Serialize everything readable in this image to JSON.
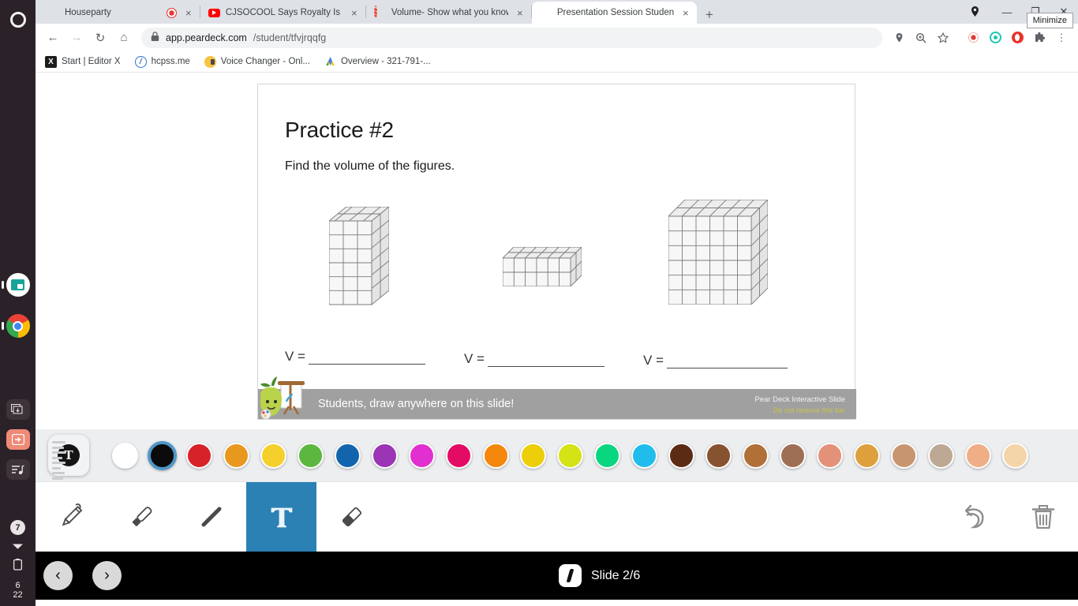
{
  "os_sidebar": {
    "top_icon": "circle-icon",
    "apps": [
      {
        "name": "files-app",
        "icon": "teal-folder-icon"
      },
      {
        "name": "chrome-app",
        "icon": "chrome-icon"
      }
    ],
    "tray": [
      {
        "name": "screenshot-icon"
      },
      {
        "name": "login-icon"
      },
      {
        "name": "music-playlist-icon"
      }
    ],
    "status": {
      "badge": "7",
      "wifi_icon": "wifi-icon",
      "battery_icon": "battery-icon"
    },
    "clock": {
      "line1": "6",
      "line2": "22"
    }
  },
  "browser": {
    "tabs": [
      {
        "title": "Houseparty",
        "favicon": "houseparty-icon",
        "active": false,
        "has_record_dot": true,
        "close_label": "×"
      },
      {
        "title": "CJSOCOOL Says Royalty Is For T",
        "favicon": "youtube-icon",
        "active": false,
        "close_label": "×"
      },
      {
        "title": "Volume- Show what you know",
        "favicon": "loading-icon",
        "active": false,
        "close_label": "×"
      },
      {
        "title": "Presentation Session Student",
        "favicon": "peardeck-icon",
        "active": true,
        "close_label": "×"
      }
    ],
    "new_tab_label": "+",
    "window_controls": {
      "location_icon": "location-pin-icon",
      "minimize": "—",
      "maximize": "❐",
      "close": "✕",
      "tooltip": "Minimize"
    },
    "nav": {
      "back": "←",
      "forward": "→",
      "reload": "↻",
      "home": "⌂"
    },
    "url": {
      "lock_icon": "lock-icon",
      "domain": "app.peardeck.com",
      "path": "/student/tfvjrqqfg"
    },
    "omni_icons": [
      {
        "name": "location-pin-icon",
        "glyph": "◎"
      },
      {
        "name": "zoom-search-icon",
        "glyph": "⌕"
      },
      {
        "name": "bookmark-star-icon",
        "glyph": "☆"
      },
      {
        "name": "recorder-extension-icon",
        "glyph": ""
      },
      {
        "name": "grammar-extension-icon",
        "glyph": ""
      },
      {
        "name": "adblock-extension-icon",
        "glyph": ""
      },
      {
        "name": "extensions-puzzle-icon",
        "glyph": "❖"
      },
      {
        "name": "chrome-menu-icon",
        "glyph": "⋮"
      }
    ],
    "bookmarks": [
      {
        "label": "Start | Editor X",
        "icon": "editorx-icon"
      },
      {
        "label": "hcpss.me",
        "icon": "hcpss-icon"
      },
      {
        "label": "Voice Changer - Onl...",
        "icon": "voicechanger-icon"
      },
      {
        "label": "Overview - 321-791-...",
        "icon": "google-meet-icon"
      }
    ]
  },
  "slide": {
    "title": "Practice #2",
    "subtitle": "Find the volume of the figures.",
    "answers": [
      {
        "label": "V =",
        "value": ""
      },
      {
        "label": "V =",
        "value": ""
      },
      {
        "label": "V =",
        "value": ""
      }
    ],
    "figures": [
      {
        "name": "rectangular-prism-tall",
        "cols": 3,
        "rows": 6,
        "depth": 2
      },
      {
        "name": "rectangular-prism-flat",
        "cols": 6,
        "rows": 2,
        "depth": 2
      },
      {
        "name": "rectangular-prism-cube",
        "cols": 6,
        "rows": 6,
        "depth": 2
      }
    ],
    "peardeck_bar": {
      "message": "Students, draw anywhere on this slide!",
      "note_line1": "Pear Deck Interactive Slide",
      "note_line2": "Do not remove this bar",
      "bar_color": "#a0a0a0",
      "note1_color": "#f2f2f2",
      "note2_color": "#c9c44a",
      "mascot": "pear-mascot-icon"
    }
  },
  "palette": {
    "active_tool_badge": "text-tool-badge",
    "active_tool_glyph": "T",
    "selected_index": 1,
    "selection_ring_color": "#4f96c8",
    "swatches": [
      {
        "name": "white",
        "hex": "#ffffff"
      },
      {
        "name": "black",
        "hex": "#0b0b0b"
      },
      {
        "name": "red",
        "hex": "#d8222a"
      },
      {
        "name": "orange",
        "hex": "#e8981e"
      },
      {
        "name": "yellow",
        "hex": "#f5cf2c"
      },
      {
        "name": "green",
        "hex": "#5cb740"
      },
      {
        "name": "blue",
        "hex": "#1265ad"
      },
      {
        "name": "purple",
        "hex": "#9b34b5"
      },
      {
        "name": "magenta",
        "hex": "#e22fd0"
      },
      {
        "name": "pink",
        "hex": "#e30b64"
      },
      {
        "name": "dark-orange",
        "hex": "#f4870c"
      },
      {
        "name": "gold",
        "hex": "#ecce09"
      },
      {
        "name": "lime",
        "hex": "#d4e316"
      },
      {
        "name": "spring-green",
        "hex": "#0ad67f"
      },
      {
        "name": "cyan",
        "hex": "#20bdec"
      },
      {
        "name": "dark-brown",
        "hex": "#5b2b14"
      },
      {
        "name": "brown",
        "hex": "#87522f"
      },
      {
        "name": "medium-brown",
        "hex": "#b07038"
      },
      {
        "name": "taupe-brown",
        "hex": "#9e6f55"
      },
      {
        "name": "salmon",
        "hex": "#e39279"
      },
      {
        "name": "amber-tan",
        "hex": "#dda03c"
      },
      {
        "name": "tan",
        "hex": "#c79671"
      },
      {
        "name": "warm-grey",
        "hex": "#bda893"
      },
      {
        "name": "light-peach",
        "hex": "#efae85"
      },
      {
        "name": "pale-peach",
        "hex": "#f4d5aa"
      }
    ]
  },
  "toolbar": {
    "tools": [
      {
        "name": "pencil-tool",
        "icon": "pencil-icon",
        "active": false
      },
      {
        "name": "marker-tool",
        "icon": "marker-icon",
        "active": false
      },
      {
        "name": "line-tool",
        "icon": "line-icon",
        "active": false
      },
      {
        "name": "text-tool",
        "icon": "text-t-icon",
        "active": true,
        "glyph": "T"
      },
      {
        "name": "eraser-tool",
        "icon": "eraser-icon",
        "active": false
      }
    ],
    "actions": [
      {
        "name": "undo-button",
        "icon": "undo-arrow-icon"
      },
      {
        "name": "delete-button",
        "icon": "trash-icon"
      }
    ],
    "active_color": "#2b81b4"
  },
  "bottom_nav": {
    "prev_label": "‹",
    "next_label": "›",
    "slide_indicator_icon": "peardeck-logo-icon",
    "slide_label": "Slide 2/6",
    "current_slide": 2,
    "total_slides": 6,
    "bar_color": "#000000"
  }
}
